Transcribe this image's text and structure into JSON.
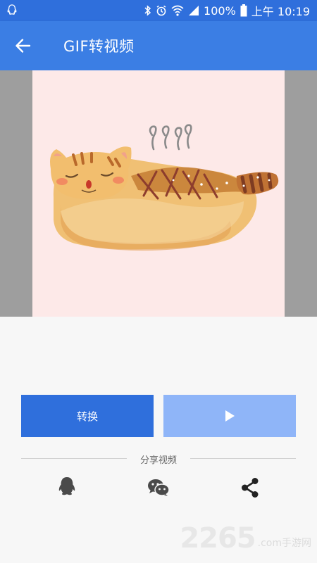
{
  "status_bar": {
    "battery": "100%",
    "time": "上午 10:19",
    "icons": [
      "qq-notification-icon",
      "bluetooth-icon",
      "alarm-icon",
      "wifi-icon",
      "signal-icon",
      "battery-icon"
    ]
  },
  "app_bar": {
    "title": "GIF转视频",
    "back_icon": "arrow-left-icon"
  },
  "preview": {
    "content": "gif-preview-image",
    "icons": [
      "cat-loaf-illustration"
    ]
  },
  "actions": {
    "convert_label": "转换",
    "play_icon": "play-icon"
  },
  "share": {
    "label": "分享视频",
    "targets": [
      "qq-icon",
      "wechat-icon",
      "share-icon"
    ]
  },
  "watermark": {
    "number": "2265",
    "suffix": ".com手游网"
  },
  "colors": {
    "status_bar": "#2f6fdc",
    "app_bar": "#3b7ee4",
    "primary_button": "#2f6fdc",
    "disabled_button": "#8fb5f8",
    "preview_bg": "#fde9e8"
  }
}
